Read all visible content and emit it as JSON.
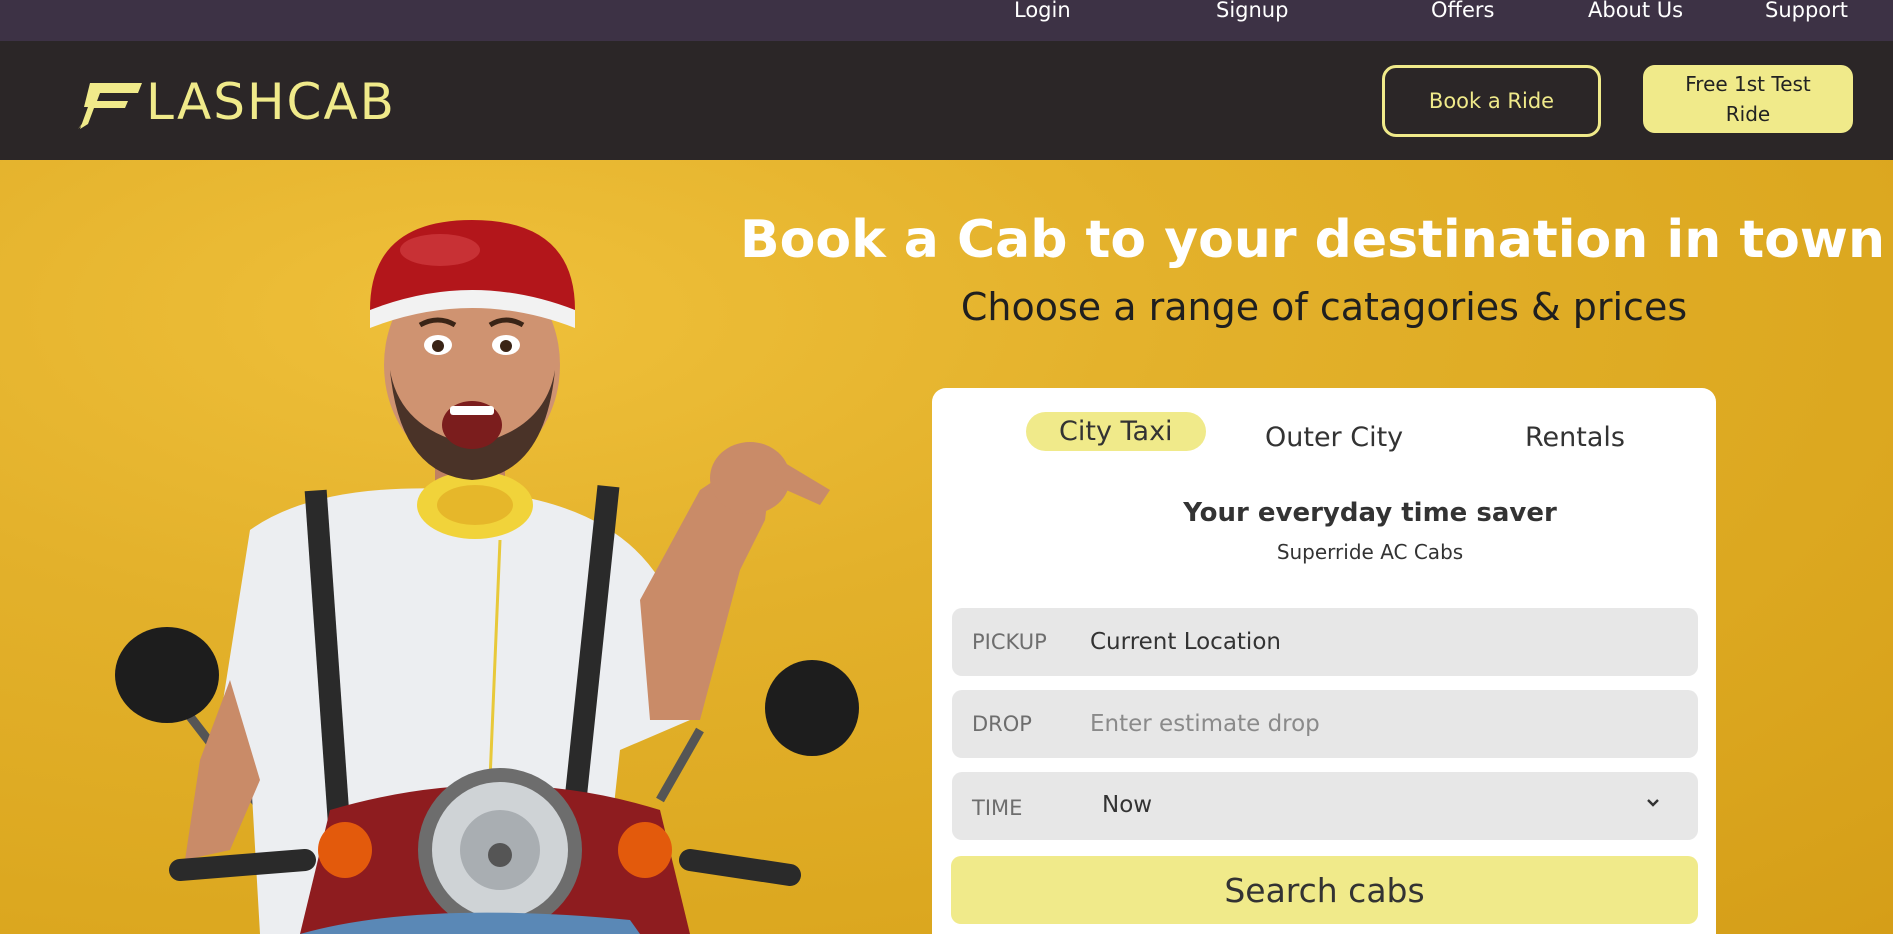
{
  "topnav": {
    "items": [
      "Login",
      "Signup",
      "Offers",
      "About Us",
      "Support"
    ]
  },
  "header": {
    "logo_text": "LASHCAB",
    "book_ride": "Book a Ride",
    "free_ride": "Free 1st Test Ride"
  },
  "hero": {
    "title": "Book a Cab to your destination in town",
    "subtitle": "Choose a range of catagories & prices"
  },
  "booking": {
    "tabs": [
      "City Taxi",
      "Outer City",
      "Rentals"
    ],
    "active_tab": "City Taxi",
    "heading": "Your everyday time saver",
    "subheading": "Superride AC Cabs",
    "pickup": {
      "label": "PICKUP",
      "value": "Current Location",
      "placeholder": ""
    },
    "drop": {
      "label": "DROP",
      "value": "",
      "placeholder": "Enter estimate drop"
    },
    "time": {
      "label": "TIME",
      "value": "Now"
    },
    "search_button": "Search cabs"
  },
  "colors": {
    "topbar": "#3d3245",
    "header": "#2b2627",
    "accent": "#f0ea8a",
    "hero": "#e3b12b"
  }
}
